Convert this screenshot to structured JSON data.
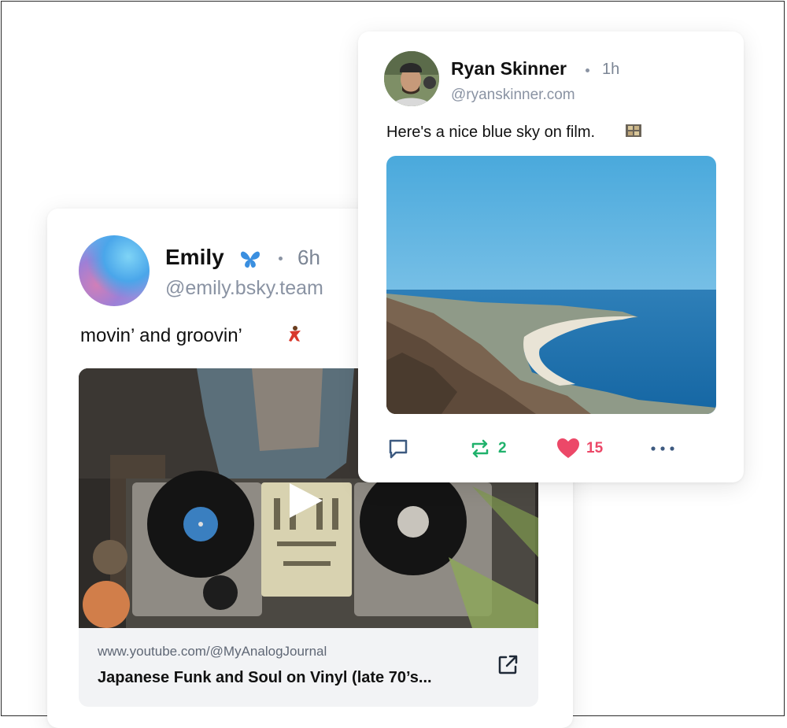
{
  "emily_post": {
    "name": "Emily",
    "time": "6h",
    "handle": "@emily.bsky.team",
    "text": "movin’ and groovin’",
    "link": {
      "url": "www.youtube.com/@MyAnalogJournal",
      "title": "Japanese Funk and Soul on Vinyl (late 70’s..."
    }
  },
  "ryan_post": {
    "name": "Ryan Skinner",
    "time": "1h",
    "handle": "@ryanskinner.com",
    "text": "Here's a nice blue sky on film.",
    "actions": {
      "repost_count": "2",
      "like_count": "15"
    }
  },
  "colors": {
    "repost": "#20b26c",
    "like": "#ec4868",
    "reply": "#3d5a80",
    "muted": "#8a93a3"
  }
}
